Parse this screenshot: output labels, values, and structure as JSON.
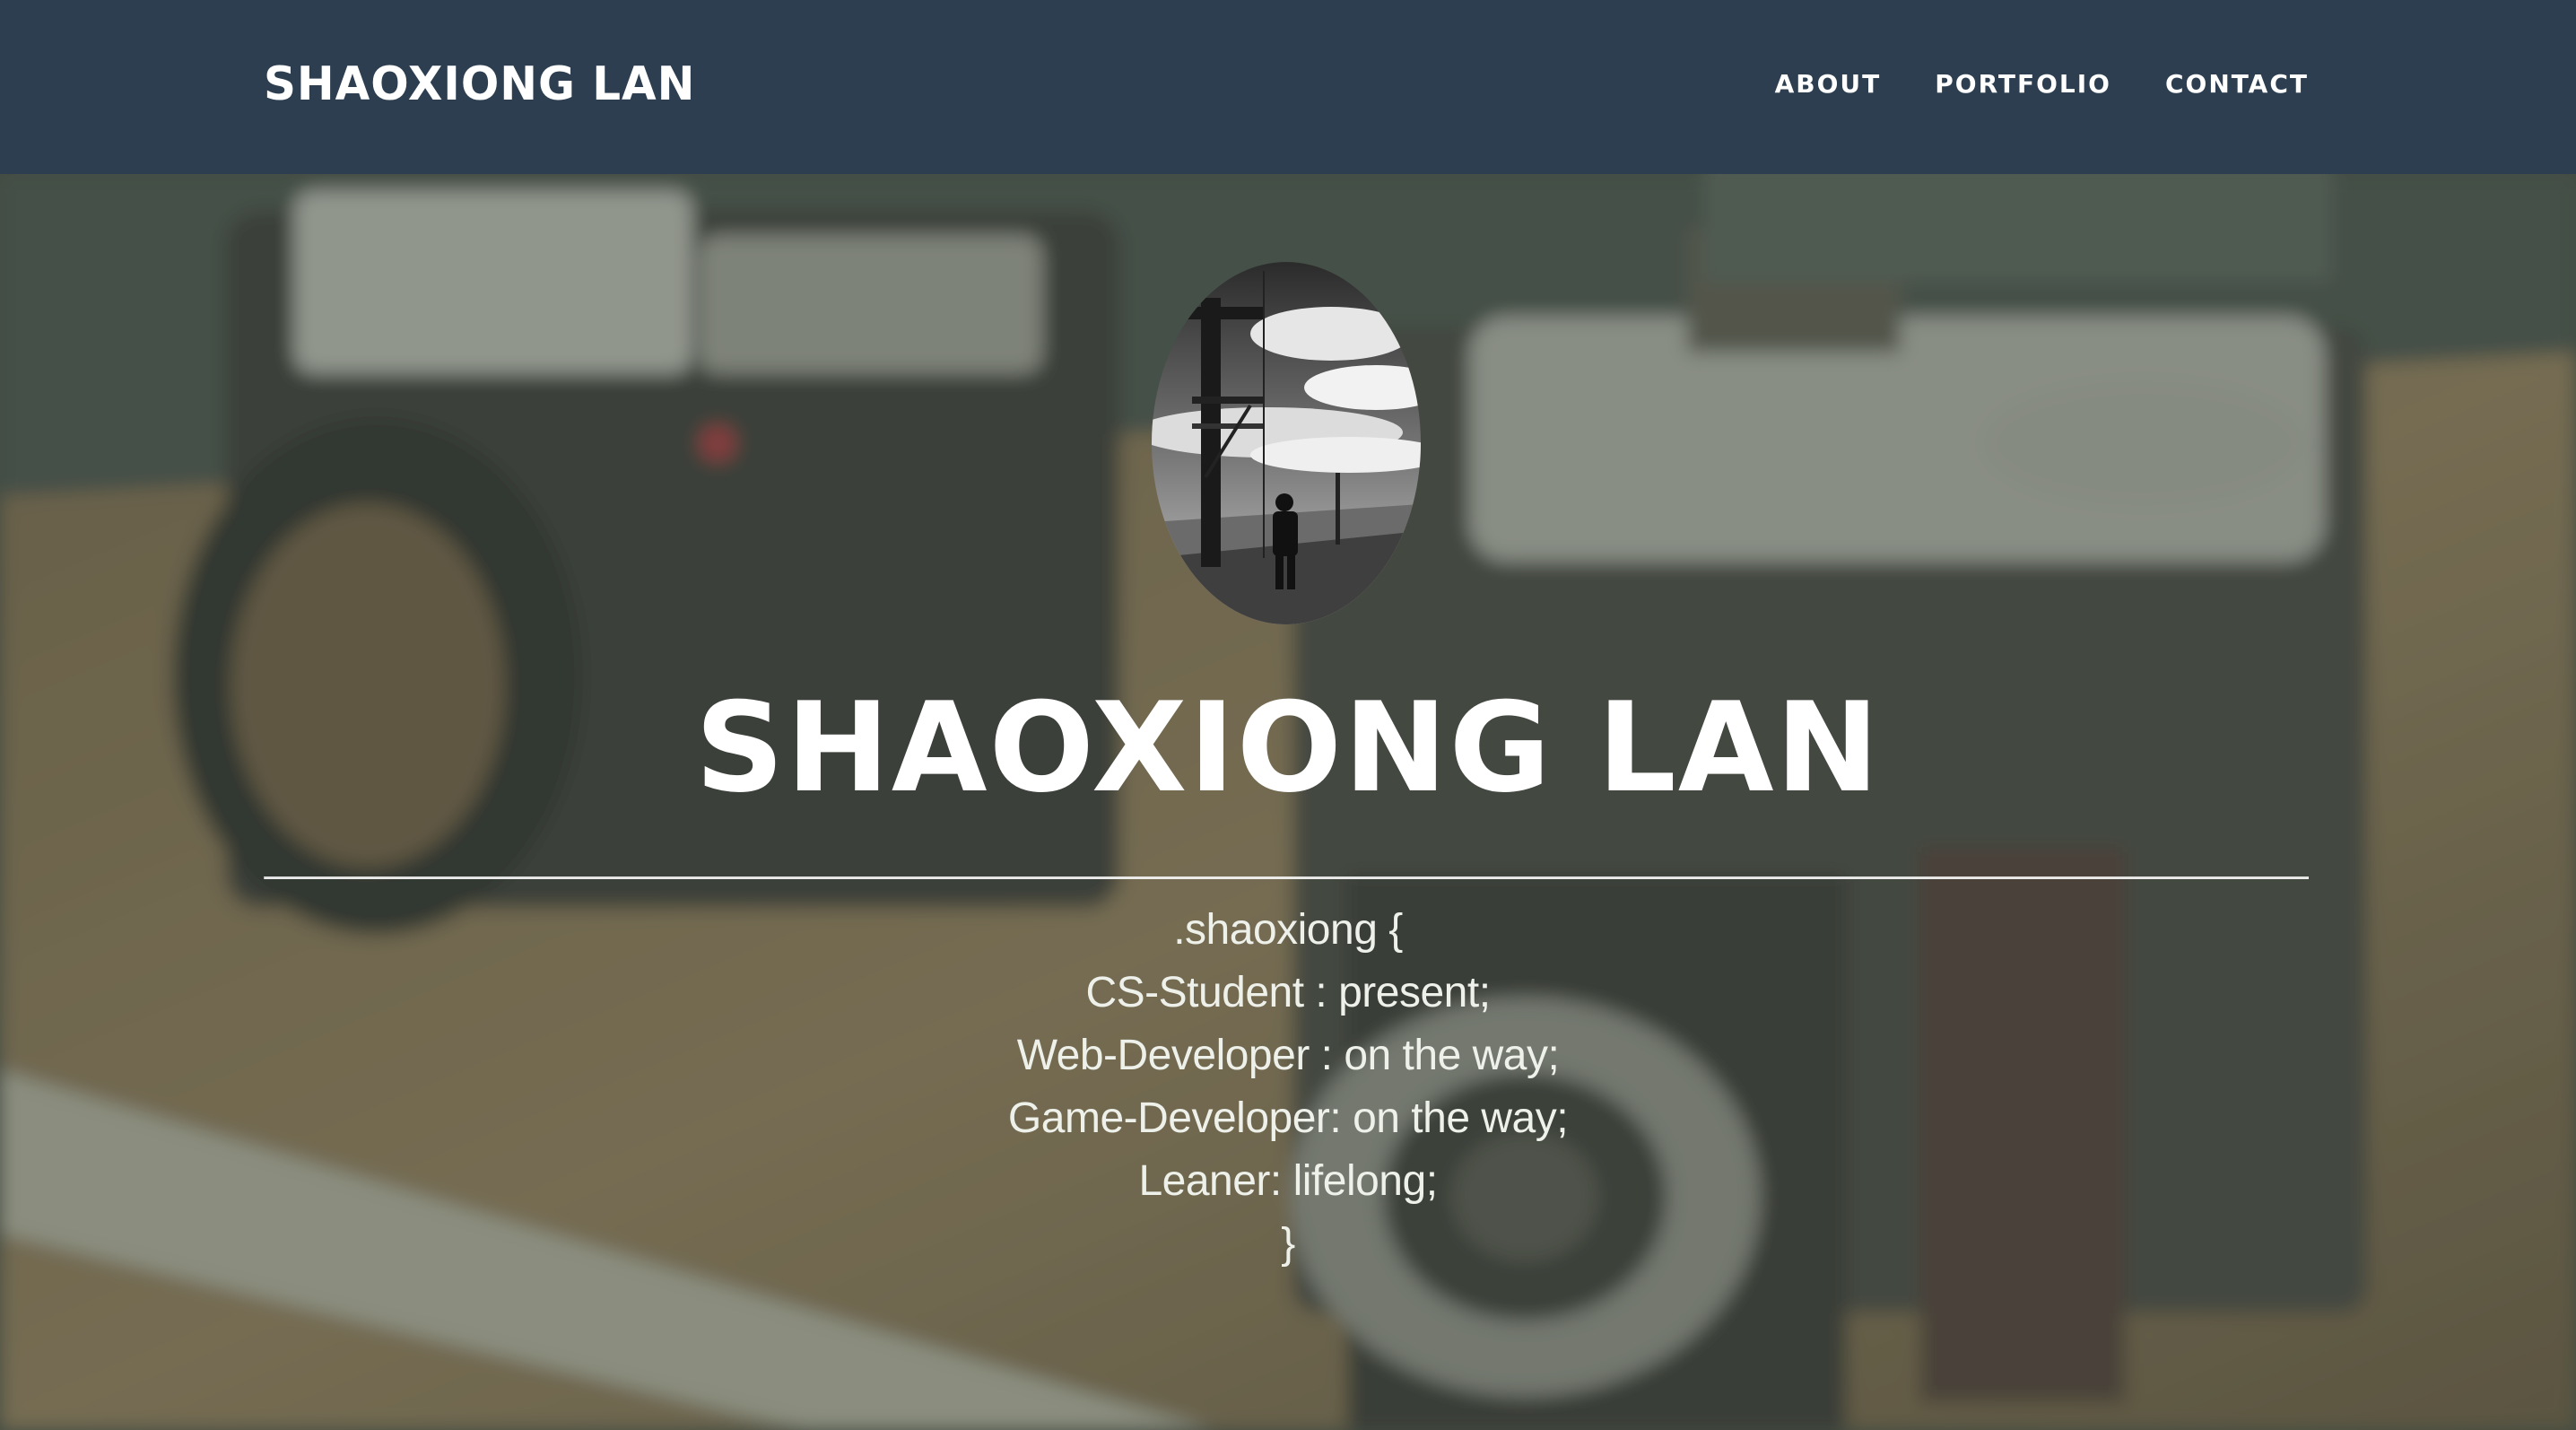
{
  "navbar": {
    "brand": "SHAOXIONG LAN",
    "links": [
      {
        "label": "ABOUT"
      },
      {
        "label": "PORTFOLIO"
      },
      {
        "label": "CONTACT"
      }
    ],
    "background_color": "#2c3e50"
  },
  "hero": {
    "title": "SHAOXIONG LAN",
    "bio_lines": [
      ".shaoxiong {",
      "CS-Student : present;",
      "Web-Developer : on the way;",
      "Game-Developer: on the way;",
      "Leaner: lifelong;",
      "}"
    ],
    "text_color": "#ffffff"
  }
}
